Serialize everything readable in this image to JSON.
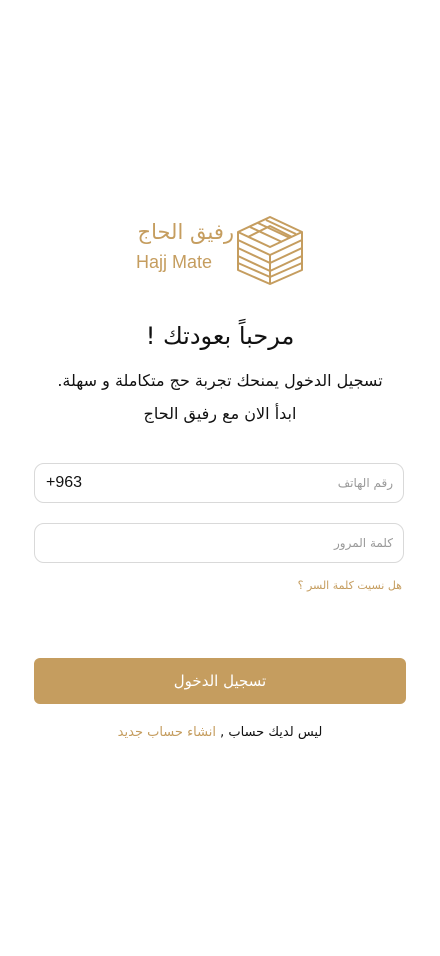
{
  "brand": {
    "name_ar": "رفيق الحاج",
    "name_en": "Hajj Mate",
    "color": "#c59d5f"
  },
  "login": {
    "title": "مرحباً بعودتك !",
    "subtitle_line1": "تسجيل الدخول يمنحك تجربة حج متكاملة و سهلة.",
    "subtitle_line2": "ابدأ الان مع رفيق الحاج",
    "phone_placeholder": "رقم الهاتف",
    "phone_prefix": "+963",
    "password_placeholder": "كلمة المرور",
    "forgot_password": "هل نسيت كلمة السر ؟",
    "login_button": "تسجيل الدخول",
    "no_account": "ليس لديك حساب ,",
    "create_account": "انشاء حساب جديد"
  },
  "icons": {
    "logo": "kaaba-logo-icon"
  }
}
